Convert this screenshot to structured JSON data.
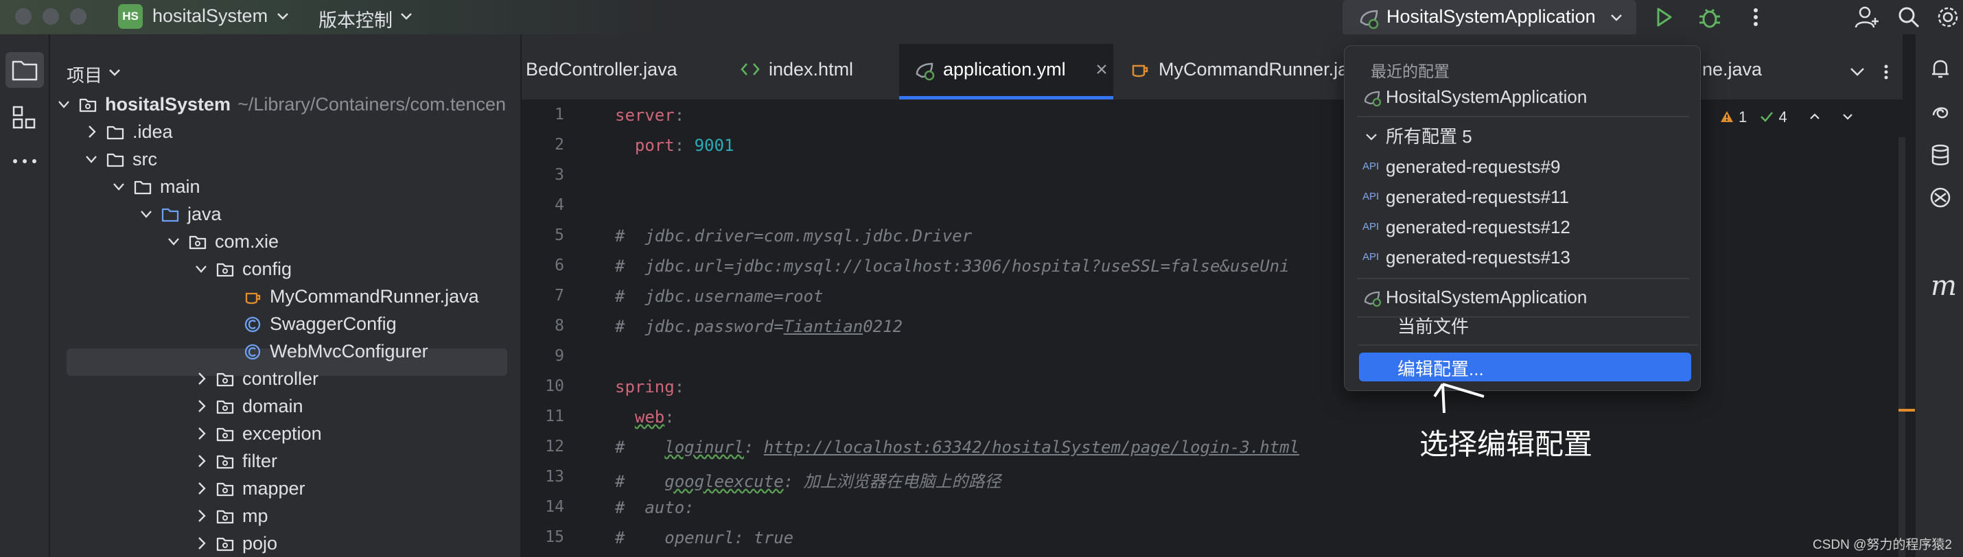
{
  "titlebar": {
    "project_badge": "HS",
    "project_name": "hositalSystem",
    "vcs_menu": "版本控制",
    "run_config": "HositalSystemApplication",
    "icons": [
      "run-icon",
      "debug-icon",
      "more-vertical-icon",
      "add-user-icon",
      "search-icon",
      "settings-icon"
    ]
  },
  "left_strip": {
    "icons": [
      "project-folder-icon",
      "structure-icon",
      "more-horizontal-icon"
    ]
  },
  "project_panel": {
    "title": "项目",
    "tree": [
      {
        "label": "hositalSystem",
        "hint": "~/Library/Containers/com.tencen",
        "icon": "module-folder-icon",
        "depth": 0,
        "expanded": true
      },
      {
        "label": ".idea",
        "icon": "folder-icon",
        "depth": 1,
        "expanded": false
      },
      {
        "label": "src",
        "icon": "folder-icon",
        "depth": 1,
        "expanded": true
      },
      {
        "label": "main",
        "icon": "folder-icon",
        "depth": 2,
        "expanded": true
      },
      {
        "label": "java",
        "icon": "source-folder-icon",
        "depth": 3,
        "expanded": true
      },
      {
        "label": "com.xie",
        "icon": "package-icon",
        "depth": 4,
        "expanded": true
      },
      {
        "label": "config",
        "icon": "package-icon",
        "depth": 5,
        "expanded": true
      },
      {
        "label": "MyCommandRunner.java",
        "icon": "java-class-cup-icon",
        "depth": 6
      },
      {
        "label": "SwaggerConfig",
        "icon": "class-icon",
        "depth": 6
      },
      {
        "label": "WebMvcConfigurer",
        "icon": "class-icon",
        "depth": 6,
        "selected": true
      },
      {
        "label": "controller",
        "icon": "package-icon",
        "depth": 5,
        "expanded": false
      },
      {
        "label": "domain",
        "icon": "package-icon",
        "depth": 5,
        "expanded": false
      },
      {
        "label": "exception",
        "icon": "package-icon",
        "depth": 5,
        "expanded": false
      },
      {
        "label": "filter",
        "icon": "package-icon",
        "depth": 5,
        "expanded": false
      },
      {
        "label": "mapper",
        "icon": "package-icon",
        "depth": 5,
        "expanded": false
      },
      {
        "label": "mp",
        "icon": "package-icon",
        "depth": 5,
        "expanded": false
      },
      {
        "label": "pojo",
        "icon": "package-icon",
        "depth": 5,
        "expanded": false
      }
    ]
  },
  "editor": {
    "tabs": [
      {
        "label": "BedController.java",
        "icon": ""
      },
      {
        "label": "index.html",
        "icon": "html-icon"
      },
      {
        "label": "application.yml",
        "icon": "spring-yml-icon",
        "active": true,
        "closable": true
      },
      {
        "label": "MyCommandRunner.ja",
        "icon": "java-class-cup-icon"
      },
      {
        "label": "ne.java",
        "icon": ""
      }
    ],
    "status": {
      "warnings": "1",
      "checks": "4"
    },
    "line_numbers": [
      "1",
      "2",
      "3",
      "4",
      "5",
      "6",
      "7",
      "8",
      "9",
      "10",
      "11",
      "12",
      "13",
      "14",
      "15"
    ],
    "lines": {
      "l1_key": "server",
      "l2_key": "port",
      "l2_val": "9001",
      "l5": "#  jdbc.driver=com.mysql.jdbc.Driver",
      "l6": "#  jdbc.url=jdbc:mysql://localhost:3306/hospital?useSSL=false&useUni",
      "l7": "#  jdbc.username=root",
      "l8_prefix": "#  jdbc.password=",
      "l8_under": "Tiantian",
      "l8_suffix": "0212",
      "l10_key": "spring",
      "l11_key": "web",
      "l12_prefix": "#    ",
      "l12_key": "loginurl",
      "l12_url": "http://localhost:63342/hositalSystem/page/login-3.html",
      "l13_prefix": "#    ",
      "l13_key": "googleexcute",
      "l13_val": "加上浏览器在电脑上的路径",
      "l14": "#  auto:",
      "l15": "#    openurl: true"
    }
  },
  "popup": {
    "recent_header": "最近的配置",
    "recent_item": "HositalSystemApplication",
    "all_header": "所有配置",
    "all_count": "5",
    "items": [
      "generated-requests#9",
      "generated-requests#11",
      "generated-requests#12",
      "generated-requests#13"
    ],
    "app_item": "HositalSystemApplication",
    "current_file": "当前文件",
    "edit_config": "编辑配置..."
  },
  "right_strip": {
    "icons": [
      "notifications-icon",
      "ai-assistant-icon",
      "database-icon",
      "gradle-icon",
      "maven-icon"
    ]
  },
  "annotation": "选择编辑配置",
  "watermark": "CSDN @努力的程序猿2",
  "colors": {
    "accent": "#3574f0",
    "bg": "#1e1f22",
    "panel": "#2b2d30",
    "keyword": "#cf8e6d",
    "number": "#2aacb8",
    "comment": "#7a7e85",
    "warning": "#e08d30"
  }
}
